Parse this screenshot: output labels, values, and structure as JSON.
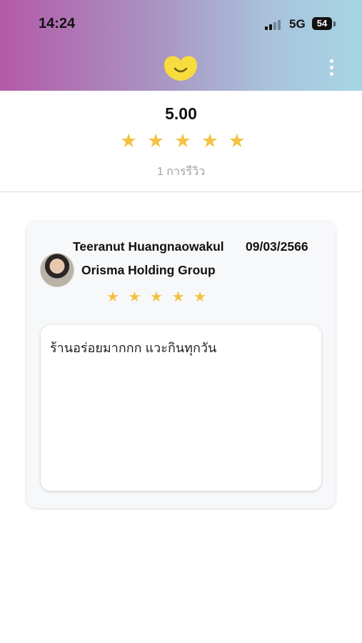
{
  "status_bar": {
    "time": "14:24",
    "network": "5G",
    "battery": "54",
    "icons": [
      "signal-icon",
      "battery-icon"
    ]
  },
  "header": {
    "logo_icon": "smile-heart-logo",
    "menu_icon": "more-vertical-icon",
    "gradient_colors": [
      "#b45aa8",
      "#a6d6e3"
    ]
  },
  "summary": {
    "score": "5.00",
    "rating": 5,
    "review_count_text": "1 การรีวิว"
  },
  "reviews": [
    {
      "reviewer": "Teeranut Huangnaowakul",
      "date": "09/03/2566",
      "company": "Orisma Holding Group",
      "rating": 5,
      "comment": "ร้านอร่อยมากกก แวะกินทุกวัน"
    }
  ],
  "colors": {
    "star": "#f4c243",
    "divider": "#dedede",
    "count_text": "#a0a0a0"
  }
}
